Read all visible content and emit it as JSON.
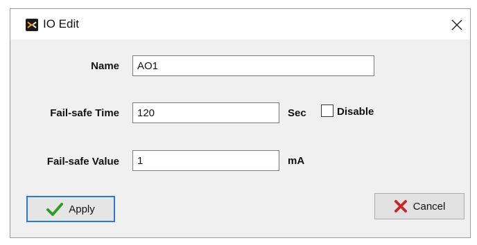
{
  "window": {
    "title": "IO Edit",
    "app_icon": "io-logo-icon",
    "close_icon": "close-icon"
  },
  "fields": {
    "name_label": "Name",
    "name_value": "AO1",
    "failsafe_time_label": "Fail-safe Time",
    "failsafe_time_value": "120",
    "failsafe_time_unit": "Sec",
    "disable_label": "Disable",
    "disable_checked": false,
    "failsafe_value_label": "Fail-safe Value",
    "failsafe_value_value": "1",
    "failsafe_value_unit": "mA"
  },
  "buttons": {
    "apply_label": "Apply",
    "apply_icon": "checkmark-icon",
    "cancel_label": "Cancel",
    "cancel_icon": "x-icon"
  },
  "colors": {
    "accent_focus": "#2a7ad3",
    "check_green": "#2f9a26",
    "cancel_red": "#c62828"
  }
}
